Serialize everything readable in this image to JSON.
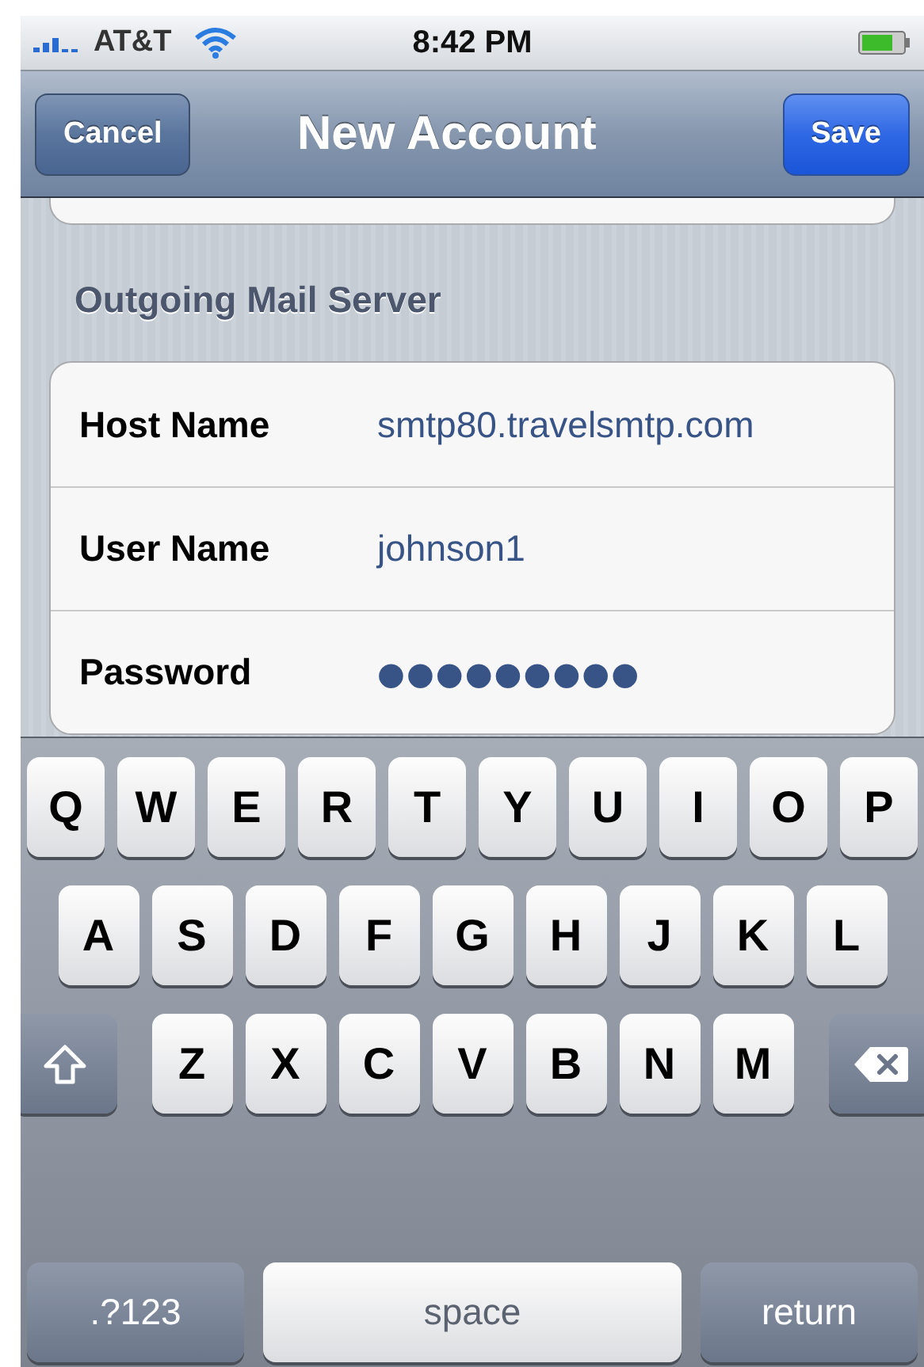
{
  "status_bar": {
    "carrier": "AT&T",
    "time": "8:42 PM"
  },
  "nav_bar": {
    "title": "New Account",
    "left_button": "Cancel",
    "right_button": "Save"
  },
  "section": {
    "header": "Outgoing Mail Server",
    "fields": [
      {
        "label": "Host Name",
        "value": "smtp80.travelsmtp.com",
        "kind": "text"
      },
      {
        "label": "User Name",
        "value": "johnson1",
        "kind": "text"
      },
      {
        "label": "Password",
        "value": "●●●●●●●●●",
        "kind": "password"
      }
    ]
  },
  "keyboard": {
    "rows": [
      [
        {
          "label": "Q",
          "kind": "letter"
        },
        {
          "label": "W",
          "kind": "letter"
        },
        {
          "label": "E",
          "kind": "letter"
        },
        {
          "label": "R",
          "kind": "letter"
        },
        {
          "label": "T",
          "kind": "letter"
        },
        {
          "label": "Y",
          "kind": "letter"
        },
        {
          "label": "U",
          "kind": "letter"
        },
        {
          "label": "I",
          "kind": "letter"
        },
        {
          "label": "O",
          "kind": "letter"
        },
        {
          "label": "P",
          "kind": "letter"
        }
      ],
      [
        {
          "label": "A",
          "kind": "letter"
        },
        {
          "label": "S",
          "kind": "letter"
        },
        {
          "label": "D",
          "kind": "letter"
        },
        {
          "label": "F",
          "kind": "letter"
        },
        {
          "label": "G",
          "kind": "letter"
        },
        {
          "label": "H",
          "kind": "letter"
        },
        {
          "label": "J",
          "kind": "letter"
        },
        {
          "label": "K",
          "kind": "letter"
        },
        {
          "label": "L",
          "kind": "letter"
        }
      ],
      [
        {
          "kind": "shift"
        },
        {
          "label": "Z",
          "kind": "letter"
        },
        {
          "label": "X",
          "kind": "letter"
        },
        {
          "label": "C",
          "kind": "letter"
        },
        {
          "label": "V",
          "kind": "letter"
        },
        {
          "label": "B",
          "kind": "letter"
        },
        {
          "label": "N",
          "kind": "letter"
        },
        {
          "label": "M",
          "kind": "letter"
        },
        {
          "kind": "delete"
        }
      ]
    ],
    "bottom_bar": [
      {
        "label": ".?123",
        "kind": "mode"
      },
      {
        "label": "space",
        "kind": "space"
      },
      {
        "label": "return",
        "kind": "return"
      }
    ]
  }
}
